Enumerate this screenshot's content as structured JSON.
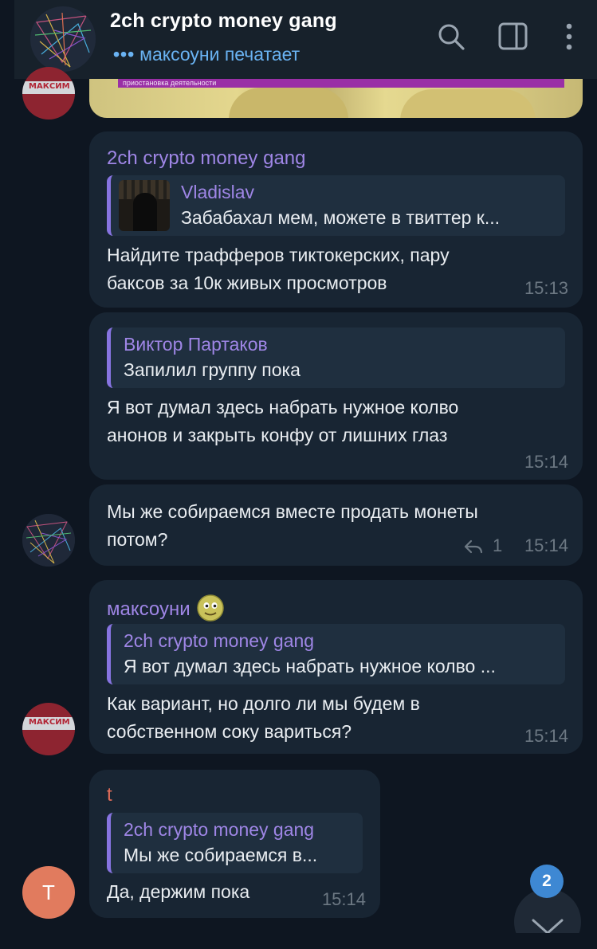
{
  "header": {
    "title": "2ch crypto money gang",
    "status_dots": "•••",
    "status_text": "максоуни печатает",
    "icons": [
      "search-icon",
      "sidebar-toggle-icon",
      "more-vertical-icon"
    ]
  },
  "media_caption": "приостановка деятельности",
  "messages": [
    {
      "sender": "2ch crypto money gang",
      "reply": {
        "name": "Vladislav",
        "text": "Забабахал мем, можете в твиттер к..."
      },
      "lines": [
        "Найдите трафферов тиктокерских, пару",
        "баксов за 10к живых просмотров"
      ],
      "time": "15:13"
    },
    {
      "reply": {
        "name": "Виктор Партаков",
        "text": "Запилил группу пока"
      },
      "lines": [
        "Я вот думал здесь набрать нужное колво",
        "анонов и закрыть конфу от лишних глаз"
      ],
      "time": "15:14"
    },
    {
      "lines": [
        "Мы же собираемся вместе продать монеты",
        "потом?"
      ],
      "replies_count": "1",
      "time": "15:14"
    },
    {
      "sender": "максоуни",
      "reply": {
        "name": "2ch crypto money gang",
        "text": "Я вот думал здесь набрать нужное колво ..."
      },
      "lines": [
        "Как вариант, но долго ли мы будем в",
        "собственном соку вариться?"
      ],
      "time": "15:14"
    },
    {
      "sender": "t",
      "reply": {
        "name": "2ch crypto money gang",
        "text": "Мы же собираемся в..."
      },
      "lines": [
        "Да, держим пока"
      ],
      "time": "15:14"
    }
  ],
  "avatars": {
    "maksim_label": "МАКСИМ",
    "t_letter": "T"
  },
  "unread_badge": "2",
  "colors": {
    "background": "#0e1621",
    "header": "#17212b",
    "bubble": "#182533",
    "accent_name": "#9f86e6",
    "status_blue": "#6ab3f3",
    "sender_t": "#e06c59",
    "badge": "#3e88d3"
  }
}
